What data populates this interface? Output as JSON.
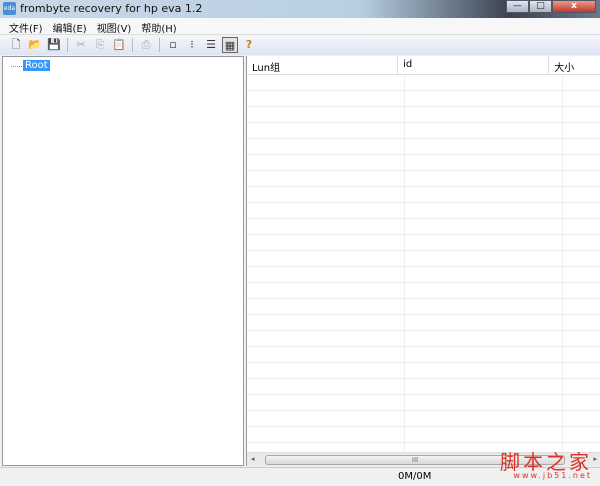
{
  "window": {
    "title": "frombyte recovery for hp eva 1.2",
    "icon_text": "eda",
    "minimize": "—",
    "maximize": "□",
    "close": "x"
  },
  "menu": [
    "文件(F)",
    "编辑(E)",
    "视图(V)",
    "帮助(H)"
  ],
  "toolbar": [
    {
      "icon": "new-file-icon",
      "glyph": "🗋"
    },
    {
      "icon": "open-folder-icon",
      "glyph": "📂"
    },
    {
      "icon": "save-icon",
      "glyph": "💾"
    },
    {
      "icon": "cut-icon",
      "glyph": "✂"
    },
    {
      "icon": "copy-icon",
      "glyph": "⎘"
    },
    {
      "icon": "paste-icon",
      "glyph": "📋"
    },
    {
      "icon": "print-icon",
      "glyph": "⎙"
    },
    {
      "icon": "large-icons-view-icon",
      "glyph": "▫"
    },
    {
      "icon": "small-icons-view-icon",
      "glyph": "⁝"
    },
    {
      "icon": "list-view-icon",
      "glyph": "☰"
    },
    {
      "icon": "details-view-icon",
      "glyph": "▦"
    },
    {
      "icon": "help-icon",
      "glyph": "?"
    }
  ],
  "tree": {
    "root": "Root"
  },
  "list": {
    "columns": [
      "Lun组",
      "id",
      "大小"
    ]
  },
  "scrollbar": {
    "grip": "III",
    "left": "◂",
    "right": "▸"
  },
  "status": {
    "text": "0M/0M"
  },
  "watermark": {
    "text": "脚本之家",
    "url": "www.jb51.net"
  }
}
